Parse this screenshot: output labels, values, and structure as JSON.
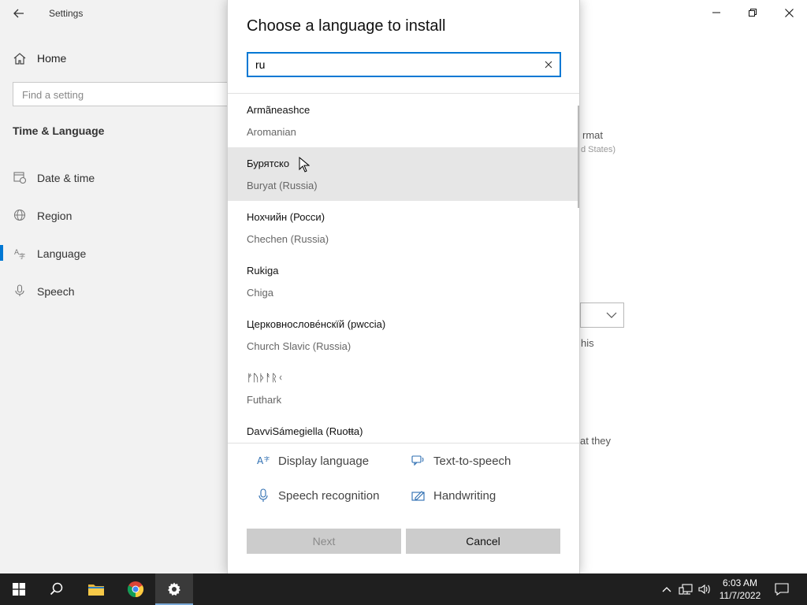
{
  "settings": {
    "title": "Settings",
    "home_label": "Home",
    "search_placeholder": "Find a setting",
    "section_title": "Time & Language",
    "nav": [
      {
        "label": "Date & time",
        "icon": "date-time-icon"
      },
      {
        "label": "Region",
        "icon": "region-globe-icon"
      },
      {
        "label": "Language",
        "icon": "language-icon",
        "active": true
      },
      {
        "label": "Speech",
        "icon": "microphone-icon"
      }
    ],
    "background_fragments": {
      "format_text": "rmat",
      "format_sub": "d States)",
      "this_text": "his",
      "they_text": "at they"
    }
  },
  "dialog": {
    "title": "Choose a language to install",
    "search_value": "ru",
    "languages": [
      {
        "native": "Armãneashce",
        "english": "Aromanian"
      },
      {
        "native": "Бурятско",
        "english": "Buryat (Russia)",
        "hover": true
      },
      {
        "native": "Нохчийн (Росси)",
        "english": "Chechen (Russia)"
      },
      {
        "native": "Rukiga",
        "english": "Chiga"
      },
      {
        "native": "Церковнослове́нскїй (рwссіа)",
        "english": "Church Slavic (Russia)"
      },
      {
        "native": "ᚠᚢᚦᚨᚱᚲ",
        "english": "Futhark"
      },
      {
        "native": "DavviSámegiella (Ruoŧŧa)",
        "english": ""
      }
    ],
    "features": {
      "display_language": "Display language",
      "text_to_speech": "Text-to-speech",
      "speech_recognition": "Speech recognition",
      "handwriting": "Handwriting"
    },
    "next_label": "Next",
    "cancel_label": "Cancel"
  },
  "taskbar": {
    "time": "6:03 AM",
    "date": "11/7/2022"
  },
  "colors": {
    "accent": "#0078d4",
    "taskbar": "#1f1f1f",
    "sidebar": "#f2f2f2",
    "button": "#cccccc"
  }
}
